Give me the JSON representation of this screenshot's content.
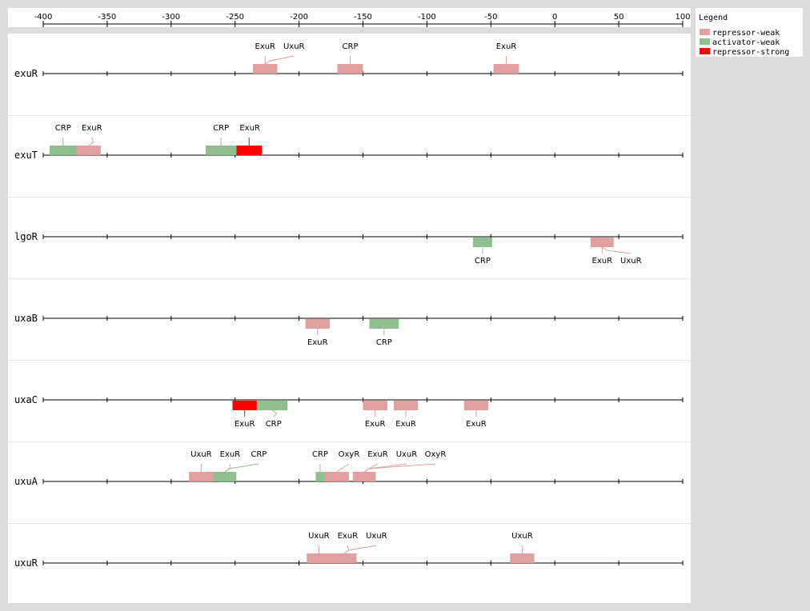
{
  "axis": {
    "min": -400,
    "max": 100,
    "ticks": [
      "-400",
      "-350",
      "-300",
      "-250",
      "-200",
      "-150",
      "-100",
      "-50",
      "0",
      "50",
      "100"
    ],
    "tick_values": [
      -400,
      -350,
      -300,
      -250,
      -200,
      -150,
      -100,
      -50,
      0,
      50,
      100
    ]
  },
  "legend": {
    "title": "Legend",
    "items": [
      {
        "label": "repressor-weak",
        "color": "#e0a0a0"
      },
      {
        "label": "activator-weak",
        "color": "#8fbf8f"
      },
      {
        "label": "repressor-strong",
        "color": "#ff0000"
      }
    ]
  },
  "chart_data": {
    "type": "diagram",
    "x_range": [
      -400,
      100
    ],
    "genes": [
      {
        "name": "exuR",
        "sites": [
          {
            "label": "ExuR",
            "start": -236,
            "end": -217,
            "class": "repressor-weak",
            "side": "above"
          },
          {
            "label": "UxuR",
            "start": -236,
            "end": -217,
            "class": "repressor-weak",
            "side": "above"
          },
          {
            "label": "CRP",
            "start": -170,
            "end": -150,
            "class": "repressor-weak",
            "side": "above"
          },
          {
            "label": "ExuR",
            "start": -48,
            "end": -28,
            "class": "repressor-weak",
            "side": "above"
          }
        ]
      },
      {
        "name": "exuT",
        "sites": [
          {
            "label": "CRP",
            "start": -395,
            "end": -374,
            "class": "activator-weak",
            "side": "above"
          },
          {
            "label": "ExuR",
            "start": -374,
            "end": -355,
            "class": "repressor-weak",
            "side": "above"
          },
          {
            "label": "CRP",
            "start": -273,
            "end": -249,
            "class": "activator-weak",
            "side": "above"
          },
          {
            "label": "ExuR",
            "start": -249,
            "end": -229,
            "class": "repressor-strong",
            "side": "above"
          }
        ]
      },
      {
        "name": "lgoR",
        "sites": [
          {
            "label": "CRP",
            "start": -64,
            "end": -49,
            "class": "activator-weak",
            "side": "below"
          },
          {
            "label": "ExuR",
            "start": 28,
            "end": 46,
            "class": "repressor-weak",
            "side": "below"
          },
          {
            "label": "UxuR",
            "start": 28,
            "end": 46,
            "class": "repressor-weak",
            "side": "below"
          }
        ]
      },
      {
        "name": "uxaB",
        "sites": [
          {
            "label": "ExuR",
            "start": -195,
            "end": -176,
            "class": "repressor-weak",
            "side": "below"
          },
          {
            "label": "CRP",
            "start": -145,
            "end": -122,
            "class": "activator-weak",
            "side": "below"
          }
        ]
      },
      {
        "name": "uxaC",
        "sites": [
          {
            "label": "ExuR",
            "start": -252,
            "end": -233,
            "class": "repressor-strong",
            "side": "below"
          },
          {
            "label": "CRP",
            "start": -233,
            "end": -209,
            "class": "activator-weak",
            "side": "below"
          },
          {
            "label": "ExuR",
            "start": -150,
            "end": -131,
            "class": "repressor-weak",
            "side": "below"
          },
          {
            "label": "ExuR",
            "start": -126,
            "end": -107,
            "class": "repressor-weak",
            "side": "below"
          },
          {
            "label": "ExuR",
            "start": -71,
            "end": -52,
            "class": "repressor-weak",
            "side": "below"
          }
        ]
      },
      {
        "name": "uxuA",
        "sites": [
          {
            "label": "UxuR",
            "start": -286,
            "end": -267,
            "class": "repressor-weak",
            "side": "above"
          },
          {
            "label": "ExuR",
            "start": -267,
            "end": -249,
            "class": "activator-weak",
            "side": "above"
          },
          {
            "label": "CRP",
            "start": -267,
            "end": -249,
            "class": "activator-weak",
            "side": "above"
          },
          {
            "label": "CRP",
            "start": -187,
            "end": -180,
            "class": "activator-weak",
            "side": "above"
          },
          {
            "label": "OxyR",
            "start": -180,
            "end": -161,
            "class": "repressor-weak",
            "side": "above"
          },
          {
            "label": "ExuR",
            "start": -158,
            "end": -140,
            "class": "repressor-weak",
            "side": "above"
          },
          {
            "label": "UxuR",
            "start": -158,
            "end": -140,
            "class": "repressor-weak",
            "side": "above"
          },
          {
            "label": "OxyR",
            "start": -158,
            "end": -140,
            "class": "repressor-weak",
            "side": "above"
          }
        ]
      },
      {
        "name": "uxuR",
        "sites": [
          {
            "label": "UxuR",
            "start": -194,
            "end": -175,
            "class": "repressor-weak",
            "side": "above"
          },
          {
            "label": "ExuR",
            "start": -175,
            "end": -155,
            "class": "repressor-weak",
            "side": "above"
          },
          {
            "label": "UxuR",
            "start": -175,
            "end": -155,
            "class": "repressor-weak",
            "side": "above"
          },
          {
            "label": "UxuR",
            "start": -35,
            "end": -16,
            "class": "repressor-weak",
            "side": "above"
          }
        ]
      }
    ]
  }
}
